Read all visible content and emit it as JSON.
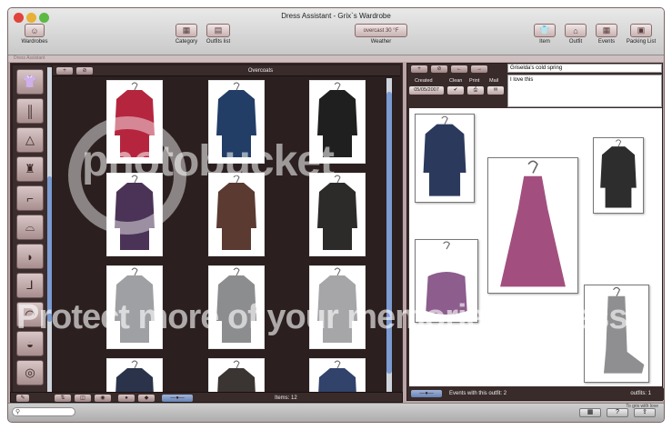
{
  "window": {
    "title": "Dress Assistant - Grix`s Wardrobe"
  },
  "toolbar": {
    "wardrobes": "Wardrobes",
    "category": "Category",
    "outfits_list": "Outfits list",
    "weather_value": "overcast 30 °F",
    "weather": "Weather",
    "item": "Item",
    "outfit": "Outfit",
    "events": "Events",
    "packing_list": "Packing List"
  },
  "subbar": {
    "text": "Dress Assistant"
  },
  "grid": {
    "title": "Overcoats",
    "items_count": "Items: 12",
    "items": [
      {
        "name": "red-coat",
        "color": "#b5263e"
      },
      {
        "name": "navy-coat",
        "color": "#223e67"
      },
      {
        "name": "black-coat",
        "color": "#1f1f1f"
      },
      {
        "name": "purple-coat",
        "color": "#4b3357"
      },
      {
        "name": "brown-wrap-coat",
        "color": "#5b3a31"
      },
      {
        "name": "black-hooded-coat",
        "color": "#2c2b2a"
      },
      {
        "name": "grey-hooded-coat",
        "color": "#9ea0a3"
      },
      {
        "name": "grey-coat",
        "color": "#8c8d8f"
      },
      {
        "name": "grey-raincoat",
        "color": "#a6a6a8"
      },
      {
        "name": "navy-short-coat",
        "color": "#2a334a"
      },
      {
        "name": "dark-coat",
        "color": "#3a3533"
      },
      {
        "name": "blue-jacket",
        "color": "#31426b"
      }
    ]
  },
  "outfit": {
    "name": "Griselda's cold spring",
    "notes": "I love this",
    "created_label": "Created",
    "created_value": "05/05/2007",
    "clean_label": "Clean",
    "print_label": "Print",
    "mail_label": "Mail",
    "events_text": "Events with this outfit: 2",
    "outfits_count": "outfits: 1",
    "cards": [
      {
        "name": "navy-cardigan",
        "color": "#2b3a5c"
      },
      {
        "name": "pink-dress",
        "color": "#a24f7f"
      },
      {
        "name": "black-trench",
        "color": "#2d2d2d"
      },
      {
        "name": "purple-bag",
        "color": "#8c5d8d"
      },
      {
        "name": "grey-boot",
        "color": "#8f8f92"
      }
    ]
  },
  "status": {
    "text": "To grix with love"
  },
  "watermark": {
    "line1": "photobucket",
    "line2": "Protect more of your memories for less!"
  }
}
